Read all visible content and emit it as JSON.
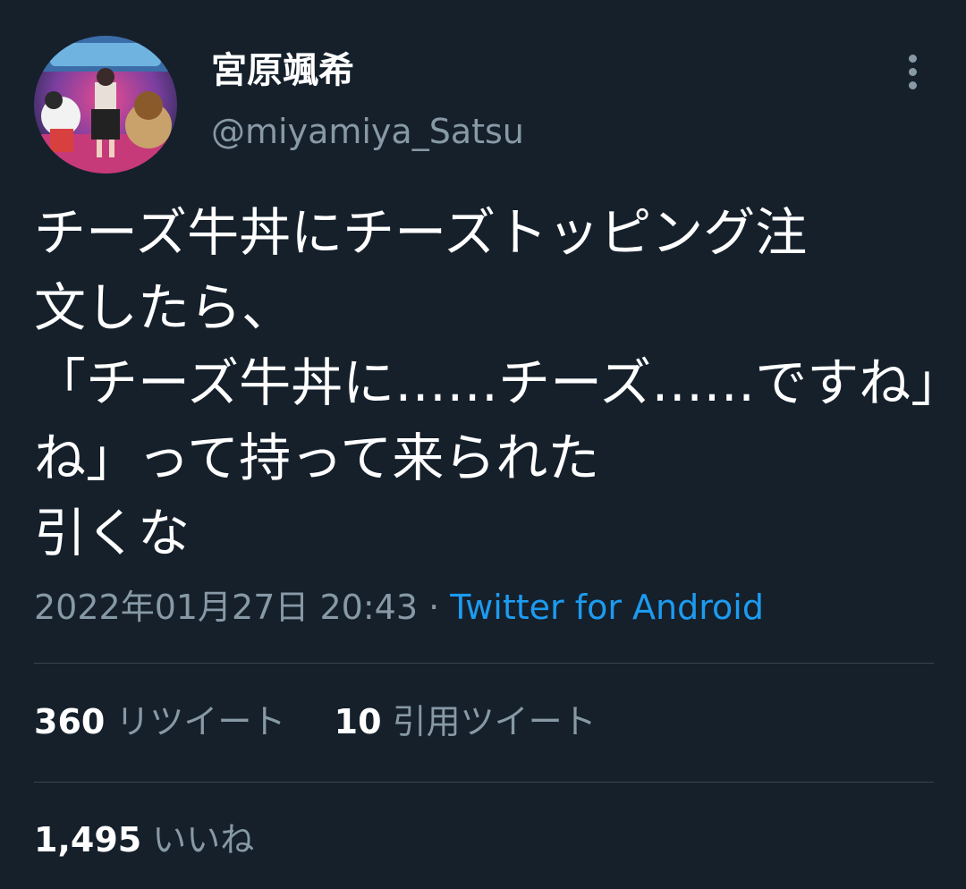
{
  "tweet": {
    "author": {
      "display_name": "宮原颯希",
      "handle": "@miyamiya_Satsu"
    },
    "text_lines": [
      "チーズ牛丼にチーズトッピング注",
      "文したら、",
      "「チーズ牛丼に……チーズ……ですね」",
      "ね」って持って来られた",
      "引くな"
    ],
    "timestamp": "2022年01月27日 20:43",
    "separator": " · ",
    "source": "Twitter for Android"
  },
  "stats": {
    "retweets": {
      "count": "360",
      "label": "リツイート"
    },
    "quotes": {
      "count": "10",
      "label": "引用ツイート"
    },
    "likes": {
      "count": "1,495",
      "label": "いいね"
    }
  },
  "colors": {
    "background": "#15202b",
    "text_primary": "#ffffff",
    "text_secondary": "#8899a6",
    "link": "#1d9bf0",
    "divider": "#38444d"
  },
  "icons": {
    "more": "more-vertical-icon"
  }
}
